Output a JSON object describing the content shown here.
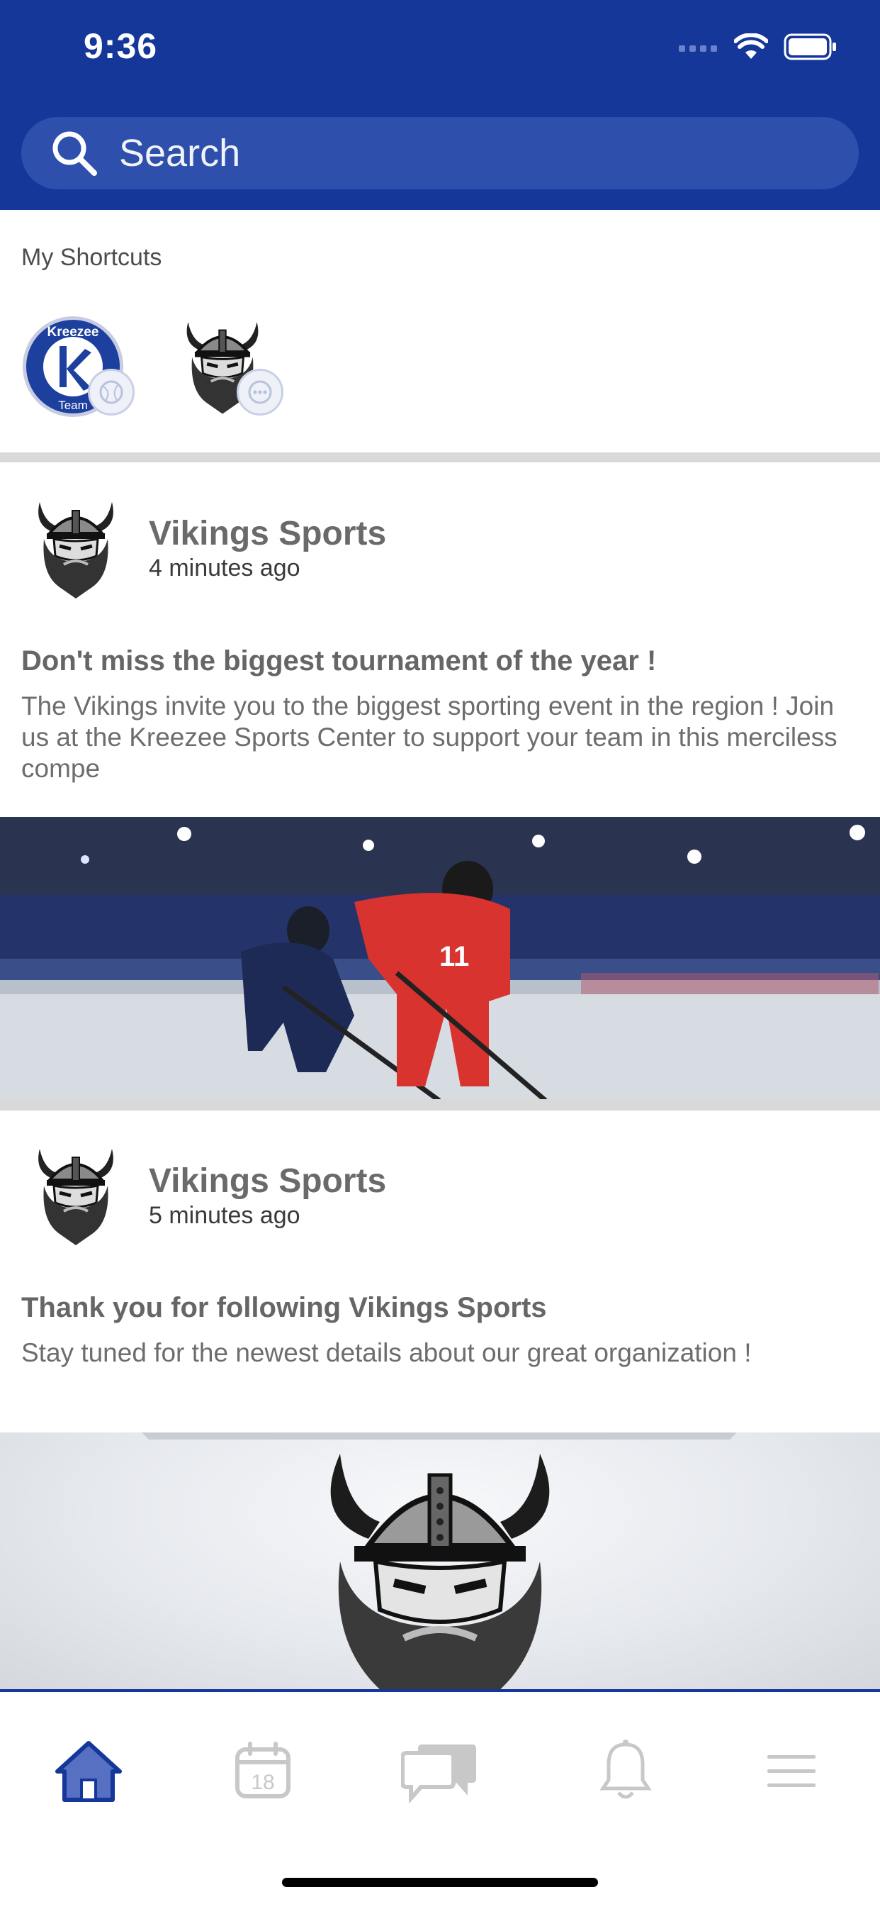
{
  "status": {
    "time": "9:36"
  },
  "search": {
    "placeholder": "Search"
  },
  "shortcuts": {
    "title": "My Shortcuts",
    "items": [
      {
        "name": "Kreezee Team",
        "logo_top": "Kreezee",
        "logo_bottom": "Team",
        "logo_letter": "K"
      },
      {
        "name": "Vikings Sports"
      }
    ]
  },
  "posts": [
    {
      "author": "Vikings Sports",
      "time": "4 minutes ago",
      "title": "Don't miss the biggest tournament of the year !",
      "body": "The Vikings invite you to the biggest sporting event in the region ! Join us at the Kreezee Sports Center to support your team in this merciless compe",
      "jersey_number": "11"
    },
    {
      "author": "Vikings Sports",
      "time": "5 minutes ago",
      "title": "Thank you for following Vikings Sports",
      "body": "Stay tuned for the newest details about our great organization !"
    }
  ],
  "tabbar": {
    "calendar_day": "18",
    "active": "home"
  },
  "colors": {
    "brand": "#15379a",
    "search_bg": "#2e50ac",
    "tab_inactive": "#c8c8c8",
    "divider": "#d9d9d9"
  }
}
